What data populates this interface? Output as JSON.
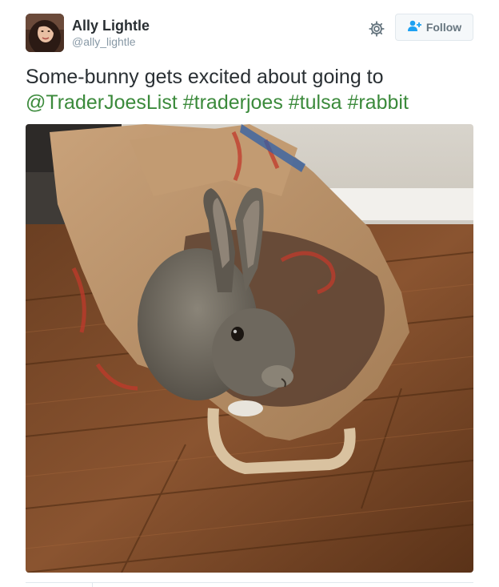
{
  "user": {
    "display_name": "Ally Lightle",
    "screen_name": "@ally_lightle",
    "avatar_icon": "profile-avatar"
  },
  "actions": {
    "settings_icon": "gear-icon",
    "follow_icon": "follow-user-icon",
    "follow_label": "Follow"
  },
  "tweet": {
    "text_plain": "Some-bunny gets excited about going to",
    "mention": "@TraderJoesList",
    "hashtags": [
      "#traderjoes",
      "#tulsa",
      "#rabbit"
    ]
  },
  "media": {
    "description_icon": "photo-rabbit-in-paper-bag"
  },
  "colors": {
    "link": "#3b8a3b",
    "name": "#292f33",
    "muted": "#8899a6",
    "button_border": "#e1e8ed",
    "button_bg": "#f5f8fa"
  }
}
